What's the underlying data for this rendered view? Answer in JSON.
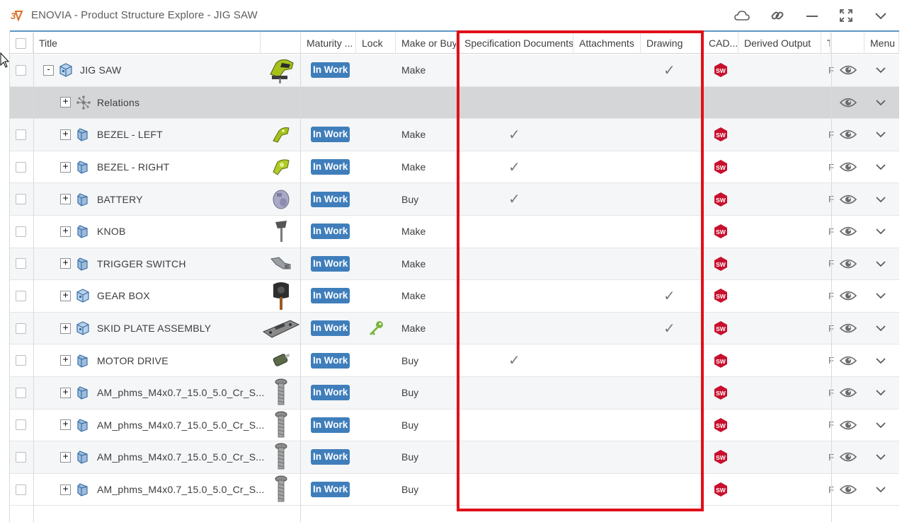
{
  "window": {
    "title": "ENOVIA - Product Structure Explore - JIG SAW",
    "icons": [
      "cloud-icon",
      "link-icon",
      "minimize-icon",
      "fullscreen-icon",
      "chevron-down-icon"
    ]
  },
  "columns": {
    "title": "Title",
    "maturity": "Maturity ...",
    "lock": "Lock",
    "make_or_buy": "Make or Buy",
    "spec_docs": "Specification Documents",
    "attachments": "Attachments",
    "drawing": "Drawing",
    "cad": "CAD...",
    "derived_output": "Derived Output",
    "t": "T",
    "menu": "Menu"
  },
  "rows": [
    {
      "title": "JIG SAW",
      "expander": "-",
      "icon": "assembly-icon",
      "thumb": "jigsaw-thumbnail",
      "maturity": "In Work",
      "lock": "",
      "make": "Make",
      "spec": "",
      "drawing": "✓",
      "cad": "SW",
      "f": "F"
    },
    {
      "title": "Relations",
      "expander": "+",
      "icon": "relations-icon",
      "relations": true
    },
    {
      "title": "BEZEL - LEFT",
      "expander": "+",
      "icon": "part-icon",
      "thumb": "bezel-left-thumbnail",
      "maturity": "In Work",
      "lock": "",
      "make": "Make",
      "spec": "✓",
      "drawing": "",
      "cad": "SW",
      "f": "F"
    },
    {
      "title": "BEZEL - RIGHT",
      "expander": "+",
      "icon": "part-icon",
      "thumb": "bezel-right-thumbnail",
      "maturity": "In Work",
      "lock": "",
      "make": "Make",
      "spec": "✓",
      "drawing": "",
      "cad": "SW",
      "f": "F"
    },
    {
      "title": "BATTERY",
      "expander": "+",
      "icon": "part-icon",
      "thumb": "battery-thumbnail",
      "maturity": "In Work",
      "lock": "",
      "make": "Buy",
      "spec": "✓",
      "drawing": "",
      "cad": "SW",
      "f": "F"
    },
    {
      "title": "KNOB",
      "expander": "+",
      "icon": "part-icon",
      "thumb": "knob-thumbnail",
      "maturity": "In Work",
      "lock": "",
      "make": "Make",
      "spec": "",
      "drawing": "",
      "cad": "SW",
      "f": "F"
    },
    {
      "title": "TRIGGER SWITCH",
      "expander": "+",
      "icon": "part-icon",
      "thumb": "trigger-switch-thumbnail",
      "maturity": "In Work",
      "lock": "",
      "make": "Make",
      "spec": "",
      "drawing": "",
      "cad": "SW",
      "f": "F"
    },
    {
      "title": "GEAR BOX",
      "expander": "+",
      "icon": "assembly-icon",
      "thumb": "gear-box-thumbnail",
      "maturity": "In Work",
      "lock": "",
      "make": "Make",
      "spec": "",
      "drawing": "✓",
      "cad": "SW",
      "f": "F"
    },
    {
      "title": "SKID PLATE ASSEMBLY",
      "expander": "+",
      "icon": "assembly-icon",
      "thumb": "skid-plate-thumbnail",
      "maturity": "In Work",
      "lock": "key-icon",
      "make": "Make",
      "spec": "",
      "drawing": "✓",
      "cad": "SW",
      "f": "F"
    },
    {
      "title": "MOTOR DRIVE",
      "expander": "+",
      "icon": "part-icon",
      "thumb": "motor-drive-thumbnail",
      "maturity": "In Work",
      "lock": "",
      "make": "Buy",
      "spec": "✓",
      "drawing": "",
      "cad": "SW",
      "f": "F"
    },
    {
      "title": "AM_phms_M4x0.7_15.0_5.0_Cr_S...",
      "expander": "+",
      "icon": "part-icon",
      "thumb": "screw-thumbnail",
      "maturity": "In Work",
      "lock": "",
      "make": "Buy",
      "spec": "",
      "drawing": "",
      "cad": "SW",
      "f": "F"
    },
    {
      "title": "AM_phms_M4x0.7_15.0_5.0_Cr_S...",
      "expander": "+",
      "icon": "part-icon",
      "thumb": "screw-thumbnail",
      "maturity": "In Work",
      "lock": "",
      "make": "Buy",
      "spec": "",
      "drawing": "",
      "cad": "SW",
      "f": "F"
    },
    {
      "title": "AM_phms_M4x0.7_15.0_5.0_Cr_S...",
      "expander": "+",
      "icon": "part-icon",
      "thumb": "screw-thumbnail",
      "maturity": "In Work",
      "lock": "",
      "make": "Buy",
      "spec": "",
      "drawing": "",
      "cad": "SW",
      "f": "F"
    },
    {
      "title": "AM_phms_M4x0.7_15.0_5.0_Cr_S...",
      "expander": "+",
      "icon": "part-icon",
      "thumb": "screw-thumbnail",
      "maturity": "In Work",
      "lock": "",
      "make": "Buy",
      "spec": "",
      "drawing": "",
      "cad": "SW",
      "f": "F"
    }
  ],
  "colors": {
    "accent_blue": "#3f7ebb",
    "highlight_red": "#e0101a",
    "solidworks_red": "#c8102e",
    "relations_row": "#d5d6d7"
  }
}
